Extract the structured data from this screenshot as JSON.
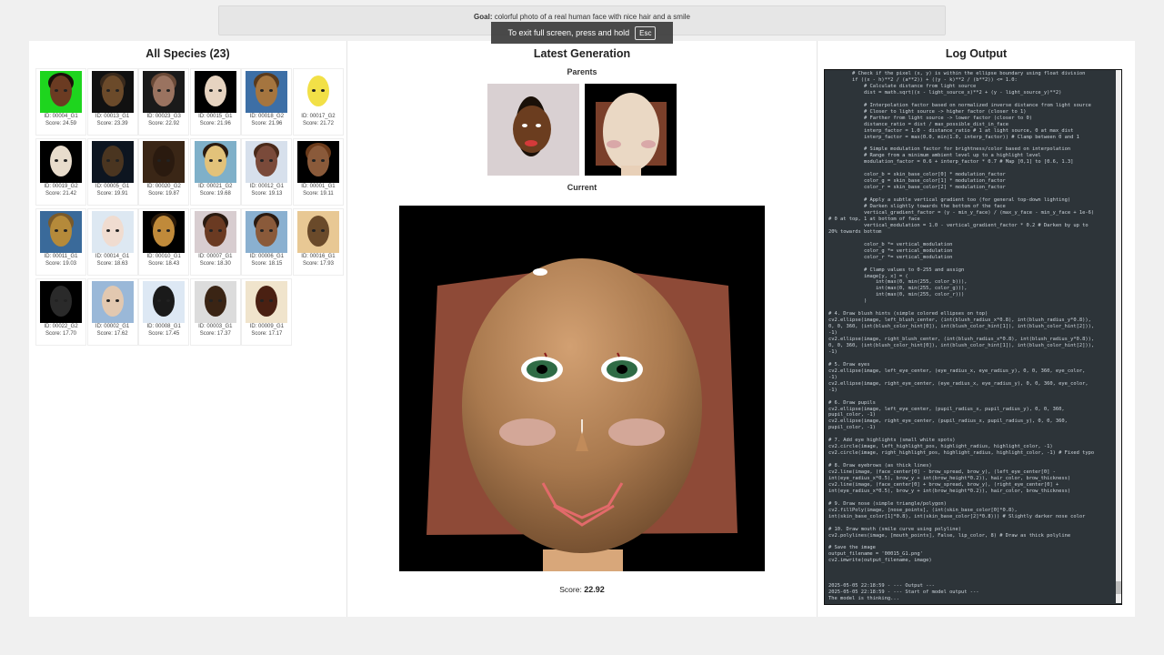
{
  "goal": {
    "label": "Goal:",
    "text": "colorful photo of a real human face with nice hair and a smile"
  },
  "fullscreen_toast": {
    "text": "To exit full screen, press and hold",
    "key": "Esc"
  },
  "species_panel": {
    "title": "All Species (23)",
    "items": [
      {
        "id": "ID: 00004_G1",
        "score": "Score: 24.59",
        "bg": "#1ed51e",
        "face": "#6b3b22",
        "hair": "#1a0f0a"
      },
      {
        "id": "ID: 00013_G1",
        "score": "Score: 23.39",
        "bg": "#111111",
        "face": "#6b4a2a",
        "hair": "#3a2a1c"
      },
      {
        "id": "ID: 00023_G3",
        "score": "Score: 22.92",
        "bg": "#1a1a1a",
        "face": "#9a7360",
        "hair": "#6a4a38"
      },
      {
        "id": "ID: 00015_G1",
        "score": "Score: 21.96",
        "bg": "#000000",
        "face": "#e6d3c0",
        "hair": "#000000"
      },
      {
        "id": "ID: 00018_G2",
        "score": "Score: 21.96",
        "bg": "#3d6fa6",
        "face": "#a5753f",
        "hair": "#5a3a1c"
      },
      {
        "id": "ID: 00017_G2",
        "score": "Score: 21.72",
        "bg": "#ffffff",
        "face": "#f2e047",
        "hair": "#ffffff"
      },
      {
        "id": "ID: 00019_G2",
        "score": "Score: 21.42",
        "bg": "#000000",
        "face": "#e8dccc",
        "hair": "#000000"
      },
      {
        "id": "ID: 00005_G1",
        "score": "Score: 19.91",
        "bg": "#0d1520",
        "face": "#4a3520",
        "hair": "#0d1520"
      },
      {
        "id": "ID: 00020_G2",
        "score": "Score: 19.87",
        "bg": "#3a2616",
        "face": "#2a1a0f",
        "hair": "#3a2616"
      },
      {
        "id": "ID: 00021_G2",
        "score": "Score: 19.68",
        "bg": "#7fb0c9",
        "face": "#e2c27a",
        "hair": "#2a1a0f"
      },
      {
        "id": "ID: 00012_G1",
        "score": "Score: 19.13",
        "bg": "#d7e0ec",
        "face": "#7a4a3a",
        "hair": "#4a2a1a"
      },
      {
        "id": "ID: 00001_G1",
        "score": "Score: 19.11",
        "bg": "#000000",
        "face": "#8a5a3a",
        "hair": "#6a3a1a"
      },
      {
        "id": "ID: 00011_G1",
        "score": "Score: 19.03",
        "bg": "#3a6a9a",
        "face": "#b58a3a",
        "hair": "#7a5a2a"
      },
      {
        "id": "ID: 00014_G1",
        "score": "Score: 18.63",
        "bg": "#dde8f2",
        "face": "#f0dcd0",
        "hair": "#dde8f2"
      },
      {
        "id": "ID: 00010_G1",
        "score": "Score: 18.43",
        "bg": "#000000",
        "face": "#c08a3a",
        "hair": "#2a1a0a"
      },
      {
        "id": "ID: 00007_G1",
        "score": "Score: 18.30",
        "bg": "#d8cdd0",
        "face": "#6a3a22",
        "hair": "#2a1a10"
      },
      {
        "id": "ID: 00006_G1",
        "score": "Score: 18.15",
        "bg": "#8ab0d0",
        "face": "#8a5a3a",
        "hair": "#2a1a10"
      },
      {
        "id": "ID: 00016_G1",
        "score": "Score: 17.93",
        "bg": "#e8c894",
        "face": "#6a4a2a",
        "hair": "#e8c894"
      },
      {
        "id": "ID: 00022_G2",
        "score": "Score: 17.70",
        "bg": "#000000",
        "face": "#2a2a2a",
        "hair": "#000000"
      },
      {
        "id": "ID: 00002_G1",
        "score": "Score: 17.62",
        "bg": "#9ab8d8",
        "face": "#e2c8b0",
        "hair": "#9ab8d8"
      },
      {
        "id": "ID: 00008_G1",
        "score": "Score: 17.45",
        "bg": "#dde8f4",
        "face": "#1a1a1a",
        "hair": "#dde8f4"
      },
      {
        "id": "ID: 00003_G1",
        "score": "Score: 17.37",
        "bg": "#dcdcdc",
        "face": "#3a2414",
        "hair": "#dcdcdc"
      },
      {
        "id": "ID: 00009_G1",
        "score": "Score: 17.17",
        "bg": "#f0e4cc",
        "face": "#4a2012",
        "hair": "#f0e4cc"
      }
    ]
  },
  "generation_panel": {
    "title": "Latest Generation",
    "parents_label": "Parents",
    "current_label": "Current",
    "score_label": "Score:",
    "score_value": "22.92"
  },
  "log_panel": {
    "title": "Log Output",
    "lines": [
      "        # Check if the pixel (x, y) is within the ellipse boundary using float division",
      "        if ((x - h)**2 / (a**2)) + ((y - k)**2 / (b**2)) <= 1.0:",
      "            # Calculate distance from light source",
      "            dist = math.sqrt((x - light_source_x)**2 + (y - light_source_y)**2)",
      "",
      "            # Interpolation factor based on normalized inverse distance from light source",
      "            # Closer to light source -> higher factor (closer to 1)",
      "            # Farther from light source -> lower factor (closer to 0)",
      "            distance_ratio = dist / max_possible_dist_in_face",
      "            interp_factor = 1.0 - distance_ratio # 1 at light source, 0 at max_dist",
      "            interp_factor = max(0.0, min(1.0, interp_factor)) # Clamp between 0 and 1",
      "",
      "            # Simple modulation factor for brightness/color based on interpolation",
      "            # Range from a minimum ambient level up to a highlight level",
      "            modulation_factor = 0.6 + interp_factor * 0.7 # Map [0,1] to [0.6, 1.3]",
      "",
      "            color_b = skin_base_color[0] * modulation_factor",
      "            color_g = skin_base_color[1] * modulation_factor",
      "            color_r = skin_base_color[2] * modulation_factor",
      "",
      "            # Apply a subtle vertical gradient too (for general top-down lighting)",
      "            # Darken slightly towards the bottom of the face",
      "            vertical_gradient_factor = (y - min_y_face) / (max_y_face - min_y_face + 1e-6)",
      "# 0 at top, 1 at bottom of face",
      "            vertical_modulation = 1.0 - vertical_gradient_factor * 0.2 # Darken by up to",
      "20% towards bottom",
      "",
      "            color_b *= vertical_modulation",
      "            color_g *= vertical_modulation",
      "            color_r *= vertical_modulation",
      "",
      "            # Clamp values to 0-255 and assign",
      "            image[y, x] = (",
      "                int(max(0, min(255, color_b))),",
      "                int(max(0, min(255, color_g))),",
      "                int(max(0, min(255, color_r)))",
      "            )",
      "",
      "# 4. Draw blush hints (simple colored ellipses on top)",
      "cv2.ellipse(image, left_blush_center, (int(blush_radius_x*0.8), int(blush_radius_y*0.8)),",
      "0, 0, 360, (int(blush_color_hint[0]), int(blush_color_hint[1]), int(blush_color_hint[2])),",
      "-1)",
      "cv2.ellipse(image, right_blush_center, (int(blush_radius_x*0.8), int(blush_radius_y*0.8)),",
      "0, 0, 360, (int(blush_color_hint[0]), int(blush_color_hint[1]), int(blush_color_hint[2])),",
      "-1)",
      "",
      "# 5. Draw eyes",
      "cv2.ellipse(image, left_eye_center, (eye_radius_x, eye_radius_y), 0, 0, 360, eye_color,",
      "-1)",
      "cv2.ellipse(image, right_eye_center, (eye_radius_x, eye_radius_y), 0, 0, 360, eye_color,",
      "-1)",
      "",
      "# 6. Draw pupils",
      "cv2.ellipse(image, left_eye_center, (pupil_radius_x, pupil_radius_y), 0, 0, 360,",
      "pupil_color, -1)",
      "cv2.ellipse(image, right_eye_center, (pupil_radius_x, pupil_radius_y), 0, 0, 360,",
      "pupil_color, -1)",
      "",
      "# 7. Add eye highlights (small white spots)",
      "cv2.circle(image, left_highlight_pos, highlight_radius, highlight_color, -1)",
      "cv2.circle(image, right_highlight_pos, highlight_radius, highlight_color, -1) # Fixed typo",
      "",
      "# 8. Draw eyebrows (as thick lines)",
      "cv2.line(image, (face_center[0] - brow_spread, brow_y), (left_eye_center[0] -",
      "int(eye_radius_x*0.5), brow_y + int(brow_height*0.2)), hair_color, brow_thickness)",
      "cv2.line(image, (face_center[0] + brow_spread, brow_y), (right_eye_center[0] +",
      "int(eye_radius_x*0.5), brow_y + int(brow_height*0.2)), hair_color, brow_thickness)",
      "",
      "# 9. Draw nose (simple triangle/polygon)",
      "cv2.fillPoly(image, [nose_points], (int(skin_base_color[0]*0.8),",
      "int(skin_base_color[1]*0.8), int(skin_base_color[2]*0.8))) # Slightly darker nose color",
      "",
      "# 10. Draw mouth (smile curve using polyline)",
      "cv2.polylines(image, [mouth_points], False, lip_color, 8) # Draw as thick polyline",
      "",
      "# Save the image",
      "output_filename = '00015_G1.png'",
      "cv2.imwrite(output_filename, image)",
      "",
      "",
      "",
      "2025-05-05 22:18:59 - --- Output ---",
      "2025-05-05 22:18:59 - --- Start of model output ---",
      "The model is thinking..."
    ]
  }
}
